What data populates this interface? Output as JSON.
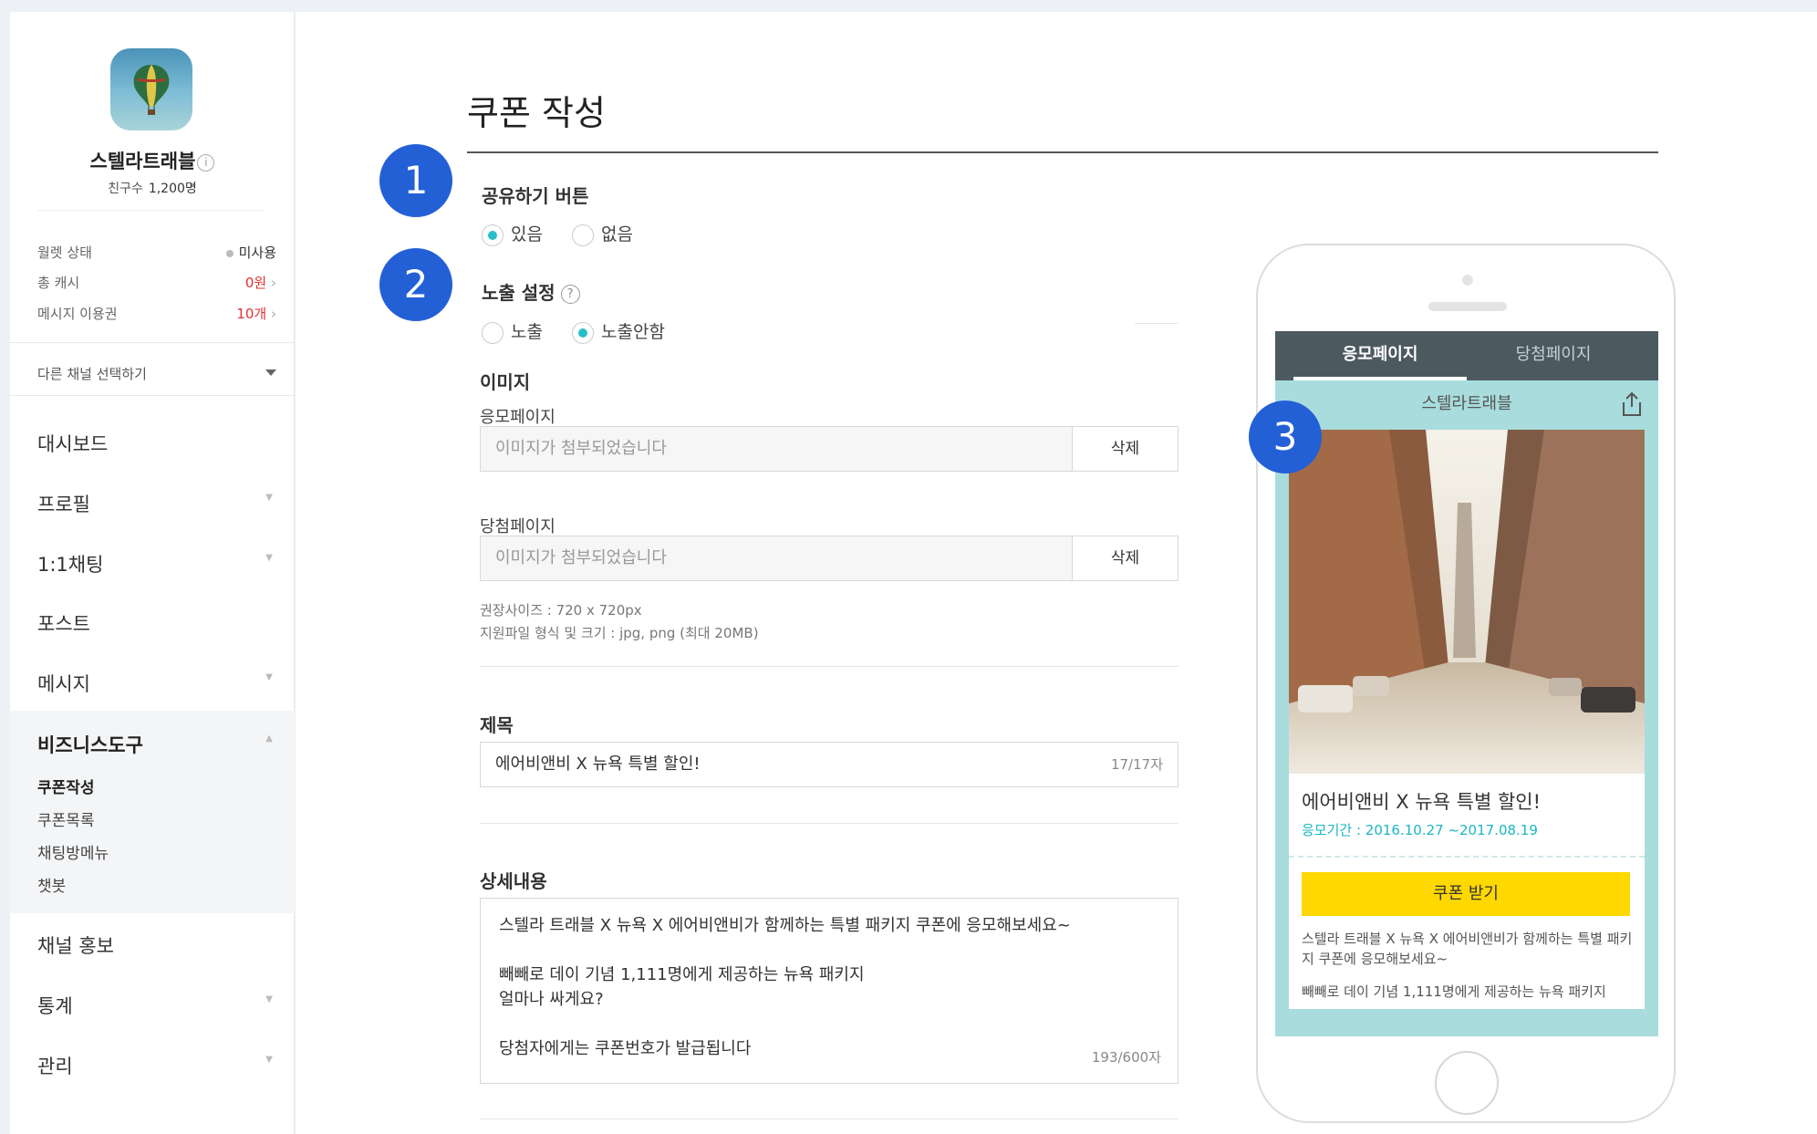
{
  "profile": {
    "name": "스텔라트래블",
    "info_glyph": "i",
    "friends_label": "친구수",
    "friends_count": "1,200명"
  },
  "stats": [
    {
      "label": "월렛 상태",
      "value": "미사용"
    },
    {
      "label": "총 캐시",
      "value": "0원"
    },
    {
      "label": "메시지 이용권",
      "value": "10개"
    }
  ],
  "channel_select": "다른 채널 선택하기",
  "nav": {
    "dashboard": "대시보드",
    "profile": "프로필",
    "chat": "1:1채팅",
    "post": "포스트",
    "message": "메시지",
    "business": "비즈니스도구",
    "business_sub": [
      "쿠폰작성",
      "쿠폰목록",
      "채팅방메뉴",
      "챗봇"
    ],
    "promo": "채널 홍보",
    "statistics": "통계",
    "manage": "관리"
  },
  "page": {
    "title": "쿠폰 작성"
  },
  "badges": [
    "1",
    "2",
    "3"
  ],
  "share": {
    "label": "공유하기 버튼",
    "option_yes": "있음",
    "option_no": "없음",
    "selected": "있음"
  },
  "exposure": {
    "label": "노출 설정",
    "help_glyph": "?",
    "option_show": "노출",
    "option_hide": "노출안함",
    "selected": "노출안함"
  },
  "image": {
    "section_label": "이미지",
    "apply_label": "응모페이지",
    "apply_value": "이미지가 첨부되었습니다",
    "win_label": "당첨페이지",
    "win_value": "이미지가 첨부되었습니다",
    "delete_label": "삭제",
    "hint_size": "권장사이즈 : 720 x 720px",
    "hint_format": "지원파일 형식 및 크기 : jpg, png (최대 20MB)"
  },
  "subject": {
    "label": "제목",
    "value": "에어비앤비 X 뉴욕 특별 할인!",
    "count": "17/17자"
  },
  "detail": {
    "label": "상세내용",
    "line1": "스텔라 트래블 X 뉴욕 X 에어비앤비가 함께하는 특별 패키지 쿠폰에 응모해보세요~",
    "line2": "빼빼로 데이 기념 1,111명에게 제공하는 뉴욕 패키지",
    "line3": "얼마나 싸게요?",
    "line4": "당첨자에게는 쿠폰번호가 발급됩니다",
    "count": "193/600자"
  },
  "preview": {
    "tab_apply": "응모페이지",
    "tab_win": "당첨페이지",
    "header": "스텔라트래블",
    "title": "에어비앤비 X 뉴욕 특별 할인!",
    "period": "응모기간 : 2016.10.27 ~2017.08.19",
    "button": "쿠폰 받기",
    "desc": "스텔라 트래블 X 뉴욕 X 에어비앤비가 함께하는 특별 패키지 쿠폰에 응모해보세요~",
    "desc2": "빼빼로 데이 기념 1,111명에게 제공하는 뉴욕 패키지"
  },
  "colors": {
    "accent_blue": "#2360d6",
    "radio_teal": "#27bfc7",
    "coupon_yellow": "#ffd800",
    "alert_red": "#e0322f"
  }
}
